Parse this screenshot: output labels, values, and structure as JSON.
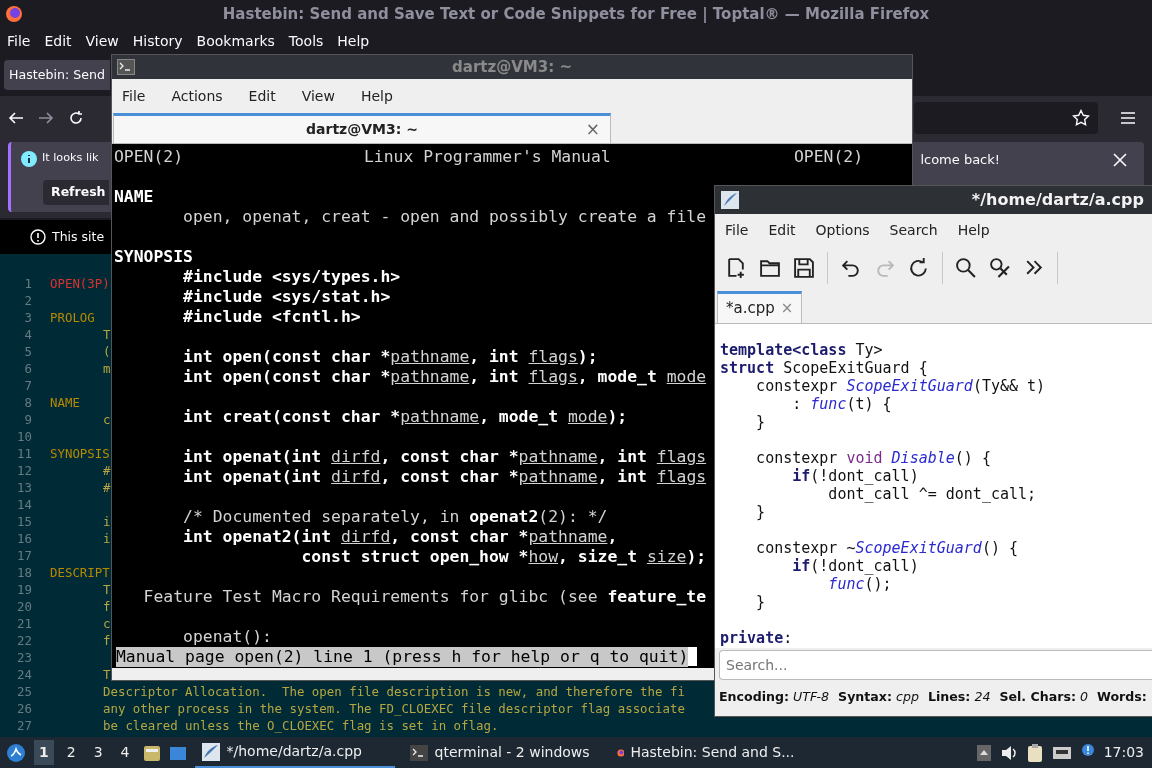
{
  "browser": {
    "title": "Hastebin: Send and Save Text or Code Snippets for Free | Toptal® — Mozilla Firefox",
    "menu": [
      "File",
      "Edit",
      "View",
      "History",
      "Bookmarks",
      "Tools",
      "Help"
    ],
    "tabs": [
      {
        "label": "Hastebin: Send",
        "selected": true
      }
    ],
    "notification": {
      "message": "It looks lik",
      "button": "Refresh",
      "message_end": "lcome back!"
    },
    "site_notice": "This site",
    "editor_lines": [
      {
        "number": "1",
        "kind": "title",
        "text": "OPEN(3P)"
      },
      {
        "number": "2"
      },
      {
        "number": "3",
        "kind": "heading",
        "text": "PROLOG"
      },
      {
        "number": "4",
        "kind": "body",
        "text": "T"
      },
      {
        "number": "5",
        "kind": "body",
        "text": "("
      },
      {
        "number": "6",
        "kind": "body",
        "text": "m"
      },
      {
        "number": "7"
      },
      {
        "number": "8",
        "kind": "heading",
        "text": "NAME"
      },
      {
        "number": "9",
        "kind": "body",
        "text": "c"
      },
      {
        "number": "10"
      },
      {
        "number": "11",
        "kind": "heading",
        "text": "SYNOPSIS"
      },
      {
        "number": "12",
        "kind": "body",
        "text": "#"
      },
      {
        "number": "13",
        "kind": "body",
        "text": "#"
      },
      {
        "number": "14"
      },
      {
        "number": "15",
        "kind": "body",
        "text": "i"
      },
      {
        "number": "16",
        "kind": "body",
        "text": "i"
      },
      {
        "number": "17"
      },
      {
        "number": "18",
        "kind": "heading",
        "text": "DESCRIPT"
      },
      {
        "number": "19",
        "kind": "body",
        "text": "T"
      },
      {
        "number": "20",
        "kind": "body",
        "text": "f"
      },
      {
        "number": "21",
        "kind": "body",
        "text": "c"
      },
      {
        "number": "22",
        "kind": "body",
        "text": "f"
      },
      {
        "number": "23"
      },
      {
        "number": "24",
        "kind": "body",
        "text": "T"
      },
      {
        "number": "25",
        "kind": "body",
        "text": "Descriptor Allocation.  The open file description is new, and therefore the fi"
      },
      {
        "number": "26",
        "kind": "body",
        "text": "any other process in the system. The FD_CLOEXEC file descriptor flag associate"
      },
      {
        "number": "27",
        "kind": "body",
        "text": "be cleared unless the O_CLOEXEC flag is set in oflag."
      }
    ]
  },
  "terminal": {
    "title": "dartz@VM3: ~",
    "menu": [
      "File",
      "Actions",
      "Edit",
      "View",
      "Help"
    ],
    "tabs": [
      {
        "label": "dartz@VM3: ~",
        "close": "×",
        "selected": true
      }
    ],
    "header": {
      "left": "OPEN(2)",
      "center": "Linux Programmer's Manual",
      "right": "OPEN(2)"
    },
    "lines": [
      {
        "kind": "blank"
      },
      {
        "kind": "text",
        "segments": [
          {
            "text": "NAME",
            "kind": "bold"
          }
        ]
      },
      {
        "kind": "text",
        "segments": [
          {
            "text": "       open, openat, creat - open and possibly create a file",
            "kind": "plain"
          }
        ]
      },
      {
        "kind": "blank"
      },
      {
        "kind": "text",
        "segments": [
          {
            "text": "SYNOPSIS",
            "kind": "bold"
          }
        ]
      },
      {
        "kind": "text",
        "segments": [
          {
            "text": "       #include <sys/types.h>",
            "kind": "bold"
          }
        ]
      },
      {
        "kind": "text",
        "segments": [
          {
            "text": "       #include <sys/stat.h>",
            "kind": "bold"
          }
        ]
      },
      {
        "kind": "text",
        "segments": [
          {
            "text": "       #include <fcntl.h>",
            "kind": "bold"
          }
        ]
      },
      {
        "kind": "blank"
      },
      {
        "kind": "text",
        "segments": [
          {
            "text": "       int open(const char *",
            "kind": "bold"
          },
          {
            "text": "pathname",
            "kind": "underline"
          },
          {
            "text": ", int ",
            "kind": "bold"
          },
          {
            "text": "flags",
            "kind": "underline"
          },
          {
            "text": ");",
            "kind": "bold"
          }
        ]
      },
      {
        "kind": "text",
        "segments": [
          {
            "text": "       int open(const char *",
            "kind": "bold"
          },
          {
            "text": "pathname",
            "kind": "underline"
          },
          {
            "text": ", int ",
            "kind": "bold"
          },
          {
            "text": "flags",
            "kind": "underline"
          },
          {
            "text": ", mode_t ",
            "kind": "bold"
          },
          {
            "text": "mode",
            "kind": "underline"
          }
        ]
      },
      {
        "kind": "blank"
      },
      {
        "kind": "text",
        "segments": [
          {
            "text": "       int creat(const char *",
            "kind": "bold"
          },
          {
            "text": "pathname",
            "kind": "underline"
          },
          {
            "text": ", mode_t ",
            "kind": "bold"
          },
          {
            "text": "mode",
            "kind": "underline"
          },
          {
            "text": ");",
            "kind": "bold"
          }
        ]
      },
      {
        "kind": "blank"
      },
      {
        "kind": "text",
        "segments": [
          {
            "text": "       int openat(int ",
            "kind": "bold"
          },
          {
            "text": "dirfd",
            "kind": "underline"
          },
          {
            "text": ", const char *",
            "kind": "bold"
          },
          {
            "text": "pathname",
            "kind": "underline"
          },
          {
            "text": ", int ",
            "kind": "bold"
          },
          {
            "text": "flags",
            "kind": "underline"
          }
        ]
      },
      {
        "kind": "text",
        "segments": [
          {
            "text": "       int openat(int ",
            "kind": "bold"
          },
          {
            "text": "dirfd",
            "kind": "underline"
          },
          {
            "text": ", const char *",
            "kind": "bold"
          },
          {
            "text": "pathname",
            "kind": "underline"
          },
          {
            "text": ", int ",
            "kind": "bold"
          },
          {
            "text": "flags",
            "kind": "underline"
          }
        ]
      },
      {
        "kind": "blank"
      },
      {
        "kind": "text",
        "segments": [
          {
            "text": "       /* Documented separately, in ",
            "kind": "plain"
          },
          {
            "text": "openat2",
            "kind": "bold"
          },
          {
            "text": "(2): */",
            "kind": "plain"
          }
        ]
      },
      {
        "kind": "text",
        "segments": [
          {
            "text": "       int openat2(int ",
            "kind": "bold"
          },
          {
            "text": "dirfd",
            "kind": "underline"
          },
          {
            "text": ", const char *",
            "kind": "bold"
          },
          {
            "text": "pathname",
            "kind": "underline"
          },
          {
            "text": ",",
            "kind": "bold"
          }
        ]
      },
      {
        "kind": "text",
        "segments": [
          {
            "text": "                   const struct open_how *",
            "kind": "bold"
          },
          {
            "text": "how",
            "kind": "underline"
          },
          {
            "text": ", size_t ",
            "kind": "bold"
          },
          {
            "text": "size",
            "kind": "underline"
          },
          {
            "text": ");",
            "kind": "bold"
          }
        ]
      },
      {
        "kind": "blank"
      },
      {
        "kind": "text",
        "segments": [
          {
            "text": "   Feature Test Macro Requirements for glibc (see ",
            "kind": "plain"
          },
          {
            "text": "feature_te",
            "kind": "bold"
          }
        ]
      },
      {
        "kind": "blank"
      },
      {
        "kind": "text",
        "segments": [
          {
            "text": "       openat():",
            "kind": "plain"
          }
        ]
      }
    ],
    "status_line": "Manual page open(2) line 1 (press h for help or q to quit)"
  },
  "text_editor": {
    "title": "*/home/dartz/a.cpp",
    "menu": [
      "File",
      "Edit",
      "Options",
      "Search",
      "Help"
    ],
    "toolbar": [
      {
        "kind": "new",
        "disabled": false
      },
      {
        "kind": "open",
        "disabled": false
      },
      {
        "kind": "save",
        "disabled": false
      },
      {
        "kind": "separator"
      },
      {
        "kind": "undo",
        "disabled": false
      },
      {
        "kind": "redo",
        "disabled": true
      },
      {
        "kind": "reload",
        "disabled": false
      },
      {
        "kind": "separator"
      },
      {
        "kind": "find",
        "disabled": false
      },
      {
        "kind": "replace",
        "disabled": false
      },
      {
        "kind": "more",
        "disabled": false
      },
      {
        "kind": "separator"
      }
    ],
    "tabs": [
      {
        "label": "*a.cpp",
        "close": "×",
        "selected": true
      }
    ],
    "code": [
      {
        "kind": "text",
        "segments": [
          {
            "text": "template<class",
            "kind": "keyword"
          },
          {
            "text": " Ty>",
            "kind": "plain"
          }
        ]
      },
      {
        "kind": "text",
        "segments": [
          {
            "text": "struct",
            "kind": "keyword"
          },
          {
            "text": " ScopeExitGuard {",
            "kind": "plain"
          }
        ]
      },
      {
        "kind": "text",
        "segments": [
          {
            "text": "    constexpr ",
            "kind": "plain"
          },
          {
            "text": "ScopeExitGuard",
            "kind": "function"
          },
          {
            "text": "(Ty&& t)",
            "kind": "plain"
          }
        ]
      },
      {
        "kind": "text",
        "segments": [
          {
            "text": "        : ",
            "kind": "plain"
          },
          {
            "text": "func",
            "kind": "function"
          },
          {
            "text": "(t) {",
            "kind": "plain"
          }
        ]
      },
      {
        "kind": "text",
        "segments": [
          {
            "text": "    }",
            "kind": "plain"
          }
        ]
      },
      {
        "kind": "blank"
      },
      {
        "kind": "text",
        "segments": [
          {
            "text": "    constexpr ",
            "kind": "plain"
          },
          {
            "text": "void ",
            "kind": "type"
          },
          {
            "text": "Disable",
            "kind": "function"
          },
          {
            "text": "() {",
            "kind": "plain"
          }
        ]
      },
      {
        "kind": "text",
        "segments": [
          {
            "text": "        if",
            "kind": "keyword"
          },
          {
            "text": "(!dont_call)",
            "kind": "plain"
          }
        ]
      },
      {
        "kind": "text",
        "segments": [
          {
            "text": "            dont_call ^= dont_call;",
            "kind": "plain"
          }
        ]
      },
      {
        "kind": "text",
        "segments": [
          {
            "text": "    }",
            "kind": "plain"
          }
        ]
      },
      {
        "kind": "blank"
      },
      {
        "kind": "text",
        "segments": [
          {
            "text": "    constexpr ~",
            "kind": "plain"
          },
          {
            "text": "ScopeExitGuard",
            "kind": "function"
          },
          {
            "text": "() {",
            "kind": "plain"
          }
        ]
      },
      {
        "kind": "text",
        "segments": [
          {
            "text": "        if",
            "kind": "keyword"
          },
          {
            "text": "(!dont_call)",
            "kind": "plain"
          }
        ]
      },
      {
        "kind": "text",
        "segments": [
          {
            "text": "            func",
            "kind": "function"
          },
          {
            "text": "();",
            "kind": "plain"
          }
        ]
      },
      {
        "kind": "text",
        "segments": [
          {
            "text": "    }",
            "kind": "plain"
          }
        ]
      },
      {
        "kind": "blank"
      },
      {
        "kind": "text",
        "segments": [
          {
            "text": "private",
            "kind": "keyword"
          },
          {
            "text": ":",
            "kind": "plain"
          }
        ]
      }
    ],
    "search": {
      "placeholder": "Search..."
    },
    "status": [
      {
        "label": "Encoding:",
        "value": "UTF-8"
      },
      {
        "label": "Syntax:",
        "value": "cpp"
      },
      {
        "label": "Lines:",
        "value": "24"
      },
      {
        "label": "Sel. Chars:",
        "value": "0"
      },
      {
        "label": "Words:"
      }
    ]
  },
  "taskbar": {
    "workspaces": [
      {
        "label": "1",
        "selected": true
      },
      {
        "label": "2",
        "selected": false
      },
      {
        "label": "3",
        "selected": false
      },
      {
        "label": "4",
        "selected": false
      }
    ],
    "tasks": [
      {
        "kind": "editor",
        "label": "*/home/dartz/a.cpp",
        "selected": true
      },
      {
        "kind": "terminal",
        "label": "qterminal - 2 windows",
        "selected": false
      },
      {
        "kind": "browser",
        "label": "Hastebin: Send and S...",
        "selected": false
      }
    ],
    "clock": "17:03"
  }
}
